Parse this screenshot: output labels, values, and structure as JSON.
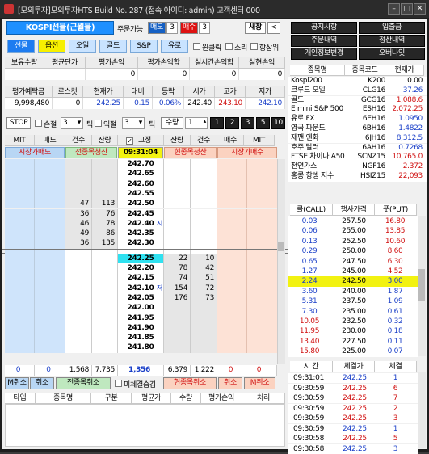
{
  "window": {
    "title": "[모의투자]모의투자HTS Build No. 287 (접속 아이디: admin) 고객센터 000"
  },
  "top": {
    "product": "KOSPI선물(근월물)",
    "order_mode_label": "주문가능",
    "sell_label": "매도",
    "sell_qty": "3",
    "buy_label": "매수",
    "buy_qty": "3",
    "refresh_label": "새창",
    "back_label": "<",
    "categories": [
      "선물",
      "옵션",
      "오일",
      "골드",
      "S&P",
      "유로"
    ],
    "one_click_label": "원클릭",
    "sound_label": "소리",
    "always_on_top_label": "항상위"
  },
  "position": {
    "headers": [
      "보유수량",
      "평균단가",
      "평가손익",
      "평가손익합",
      "실시간손익합",
      "실현손익"
    ],
    "values": [
      "",
      "",
      "0",
      "0",
      "0",
      "0"
    ]
  },
  "account": {
    "headers": [
      "평가예탁금",
      "로스컷",
      "현재가",
      "대비",
      "등락",
      "시가",
      "고가",
      "저가"
    ],
    "values": [
      "9,998,480",
      "0",
      "242.25",
      "0.15",
      "0.06%",
      "242.40",
      "243.10",
      "242.10"
    ]
  },
  "controls": {
    "stop_label": "STOP",
    "stoploss_label": "손절",
    "stoploss_val": "3",
    "tick_label": "틱",
    "takeprofit_label": "익절",
    "takeprofit_val": "3",
    "tick_label2": "틱",
    "qty_label": "수량",
    "qty_val": "1",
    "qty_buttons": [
      "1",
      "2",
      "3",
      "5",
      "10"
    ]
  },
  "orderbook": {
    "headers": [
      "MIT",
      "매도",
      "건수",
      "잔량",
      "고정",
      "잔량",
      "건수",
      "매수",
      "MIT"
    ],
    "fixed_checked": true,
    "sub_buttons": {
      "market_sell": "시장가매도",
      "clear_all_left": "전종목청산",
      "time": "09:31:04",
      "clear_current": "현종목청산",
      "market_buy": "시장가매수"
    },
    "rows": [
      {
        "price": "242.70",
        "ask_cnt": "",
        "ask_qty": "",
        "bid_qty": "",
        "bid_cnt": "",
        "mark": ""
      },
      {
        "price": "242.65",
        "ask_cnt": "",
        "ask_qty": "",
        "bid_qty": "",
        "bid_cnt": "",
        "mark": ""
      },
      {
        "price": "242.60",
        "ask_cnt": "",
        "ask_qty": "",
        "bid_qty": "",
        "bid_cnt": "",
        "mark": ""
      },
      {
        "price": "242.55",
        "ask_cnt": "",
        "ask_qty": "",
        "bid_qty": "",
        "bid_cnt": "",
        "mark": ""
      },
      {
        "price": "242.50",
        "ask_cnt": "47",
        "ask_qty": "113",
        "bid_qty": "",
        "bid_cnt": "",
        "mark": ""
      },
      {
        "price": "242.45",
        "ask_cnt": "36",
        "ask_qty": "76",
        "bid_qty": "",
        "bid_cnt": "",
        "mark": ""
      },
      {
        "price": "242.40",
        "ask_cnt": "46",
        "ask_qty": "78",
        "bid_qty": "",
        "bid_cnt": "",
        "mark": "시"
      },
      {
        "price": "242.35",
        "ask_cnt": "49",
        "ask_qty": "86",
        "bid_qty": "",
        "bid_cnt": "",
        "mark": ""
      },
      {
        "price": "242.30",
        "ask_cnt": "36",
        "ask_qty": "135",
        "bid_qty": "",
        "bid_cnt": "",
        "mark": ""
      },
      {
        "price": "",
        "ask_cnt": "",
        "ask_qty": "",
        "bid_qty": "",
        "bid_cnt": "",
        "mark": ""
      },
      {
        "price": "242.25",
        "ask_cnt": "",
        "ask_qty": "",
        "bid_qty": "22",
        "bid_cnt": "10",
        "mark": ""
      },
      {
        "price": "242.20",
        "ask_cnt": "",
        "ask_qty": "",
        "bid_qty": "78",
        "bid_cnt": "42",
        "mark": ""
      },
      {
        "price": "242.15",
        "ask_cnt": "",
        "ask_qty": "",
        "bid_qty": "74",
        "bid_cnt": "51",
        "mark": ""
      },
      {
        "price": "242.10",
        "ask_cnt": "",
        "ask_qty": "",
        "bid_qty": "154",
        "bid_cnt": "72",
        "mark": "저"
      },
      {
        "price": "242.05",
        "ask_cnt": "",
        "ask_qty": "",
        "bid_qty": "176",
        "bid_cnt": "73",
        "mark": ""
      },
      {
        "price": "242.00",
        "ask_cnt": "",
        "ask_qty": "",
        "bid_qty": "",
        "bid_cnt": "",
        "mark": ""
      },
      {
        "price": "241.95",
        "ask_cnt": "",
        "ask_qty": "",
        "bid_qty": "",
        "bid_cnt": "",
        "mark": ""
      },
      {
        "price": "241.90",
        "ask_cnt": "",
        "ask_qty": "",
        "bid_qty": "",
        "bid_cnt": "",
        "mark": ""
      },
      {
        "price": "241.85",
        "ask_cnt": "",
        "ask_qty": "",
        "bid_qty": "",
        "bid_cnt": "",
        "mark": ""
      },
      {
        "price": "241.80",
        "ask_cnt": "",
        "ask_qty": "",
        "bid_qty": "",
        "bid_cnt": "",
        "mark": ""
      }
    ],
    "totals": [
      "0",
      "0",
      "1,568",
      "7,735",
      "1,356",
      "6,379",
      "1,222",
      "0",
      "0"
    ],
    "bottom_buttons": [
      "M취소",
      "취소",
      "전종목취소",
      "미체결숨김",
      "현종목취소",
      "취소",
      "M취소"
    ]
  },
  "trades": {
    "headers": [
      "타입",
      "종목명",
      "구분",
      "평균가",
      "수량",
      "평가손익",
      "처리"
    ]
  },
  "right": {
    "menu": [
      "공지사항",
      "입출금",
      "주문내역",
      "정산내역",
      "개인정보변경",
      "오버나잇"
    ],
    "market": {
      "headers": [
        "종목명",
        "종목코드",
        "현재가"
      ],
      "rows": [
        [
          "Kospi200",
          "K200",
          "0.00"
        ],
        [
          "크루드 오일",
          "CLG16",
          "37.26"
        ],
        [
          "골드",
          "GCG16",
          "1,088.6"
        ],
        [
          "E mini S&P 500",
          "ESH16",
          "2,072.25"
        ],
        [
          "유로 FX",
          "6EH16",
          "1.0950"
        ],
        [
          "영국 파운드",
          "6BH16",
          "1.4822"
        ],
        [
          "재팬 엔화",
          "6JH16",
          "8,312.5"
        ],
        [
          "호주 달러",
          "6AH16",
          "0.7268"
        ],
        [
          "FTSE 차이나 A50",
          "SCNZ15",
          "10,765.0"
        ],
        [
          "천연가스",
          "NGF16",
          "2.372"
        ],
        [
          "홍콩 항셍 지수",
          "HSIZ15",
          "22,093"
        ]
      ]
    },
    "options": {
      "headers": [
        "콜(CALL)",
        "행사가격",
        "풋(PUT)"
      ],
      "rows": [
        [
          "0.03",
          "257.50",
          "16.80"
        ],
        [
          "0.06",
          "255.00",
          "13.85"
        ],
        [
          "0.13",
          "252.50",
          "10.60"
        ],
        [
          "0.29",
          "250.00",
          "8.60"
        ],
        [
          "0.65",
          "247.50",
          "6.30"
        ],
        [
          "1.27",
          "245.00",
          "4.52"
        ],
        [
          "2.24",
          "242.50",
          "3.00"
        ],
        [
          "3.60",
          "240.00",
          "1.87"
        ],
        [
          "5.31",
          "237.50",
          "1.09"
        ],
        [
          "7.30",
          "235.00",
          "0.61"
        ],
        [
          "10.05",
          "232.50",
          "0.32"
        ],
        [
          "11.95",
          "230.00",
          "0.18"
        ],
        [
          "13.40",
          "227.50",
          "0.11"
        ],
        [
          "15.80",
          "225.00",
          "0.07"
        ]
      ]
    },
    "ticks": {
      "headers": [
        "시 간",
        "체결가",
        "체결"
      ],
      "rows": [
        [
          "09:31:01",
          "242.25",
          "1"
        ],
        [
          "09:30:59",
          "242.25",
          "6"
        ],
        [
          "09:30:59",
          "242.25",
          "7"
        ],
        [
          "09:30:59",
          "242.25",
          "2"
        ],
        [
          "09:30:59",
          "242.25",
          "3"
        ],
        [
          "09:30:59",
          "242.25",
          "1"
        ],
        [
          "09:30:58",
          "242.25",
          "5"
        ],
        [
          "09:30:58",
          "242.25",
          "3"
        ]
      ]
    }
  },
  "colors": {
    "blue": "#1a3fc8",
    "red": "#d01010",
    "ask_bg": "#cfe4fb",
    "bid_bg": "#fde2d6",
    "cur_price_bg": "#2fe1f0",
    "time_bg": "#f2f211"
  }
}
